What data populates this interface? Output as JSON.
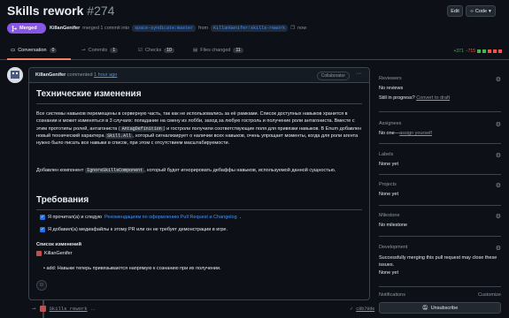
{
  "header": {
    "title": "Skills rework",
    "number": "#274",
    "edit_label": "Edit",
    "code_label": "Code",
    "status_label": "Merged",
    "author": "KillanGenifer",
    "merged_text": "merged 1 commit into",
    "base_branch": "space-syndicate:master",
    "from_text": "from",
    "head_branch": "KillanGenifer:skills-rework",
    "time": "now"
  },
  "tabs": [
    {
      "label": "Conversation",
      "count": "0"
    },
    {
      "label": "Commits",
      "count": "1"
    },
    {
      "label": "Checks",
      "count": "10"
    },
    {
      "label": "Files changed",
      "count": "11"
    }
  ],
  "diffstat": {
    "added": "+371",
    "removed": "−715"
  },
  "comment": {
    "author": "KillanGenifer",
    "commented": "commented",
    "time": "1 hour ago",
    "badge": "Collaborator",
    "h_tech": "Технические изменения",
    "p1_a": "Все системы навыков перемещены в серверную часть, так как не использовались за её рамками. Список доступных навыков хранится в сознании и может изменяться в 3 случаях: попадание на смену из лобби, заход за любую гостроль и получение роли антагониста. Вместе с этим прототипы ролей, антагониста (",
    "p1_code1": "AntagDefinition",
    "p1_b": ") и гостроли получили соответствующие поля для привязки навыков. В Enum добавлен новый технический характера ",
    "p1_code2": "Skill.All",
    "p1_c": ", который сигнализирует о наличии всех навыков, очень упрощает моменты, когда для роли агента нужно было писать все навыки в список, при этом с отсутствием масштабируемости.",
    "p2_a": "Добавлен компонент ",
    "p2_code": "IgnoreSkillsComponent",
    "p2_b": ", который будет игнорировать дебаффы навыков, используемой данной сущностью.",
    "h_req": "Требования",
    "req1_a": "Я прочитал(а) и следую ",
    "req1_link": "Рекомендациям по оформлению Pull Request и Changelog",
    "req1_b": ".",
    "req2": "Я добавил(а) медиафайлы к этому PR или он не требует демонстрации в игре.",
    "changelog_title": "Список изменений",
    "changelog_author": "KillanGenifer",
    "changelog_item": "add: Навыки теперь привязываются напрямую к сознанию при их получении."
  },
  "timeline": {
    "commit": "Skills rework",
    "sha": "c8b79de"
  },
  "sidebar": {
    "reviewers_title": "Reviewers",
    "reviewers_value": "No reviews",
    "still_progress": "Still in progress?",
    "convert_draft": "Convert to draft",
    "assignees_title": "Assignees",
    "assignees_value": "No one—",
    "assign_yourself": "assign yourself",
    "labels_title": "Labels",
    "labels_value": "None yet",
    "projects_title": "Projects",
    "projects_value": "None yet",
    "milestone_title": "Milestone",
    "milestone_value": "No milestone",
    "development_title": "Development",
    "development_value": "Successfully merging this pull request may close these issues.",
    "development_none": "None yet",
    "notifications_title": "Notifications",
    "customize": "Customize",
    "unsubscribe": "Unsubscribe"
  }
}
